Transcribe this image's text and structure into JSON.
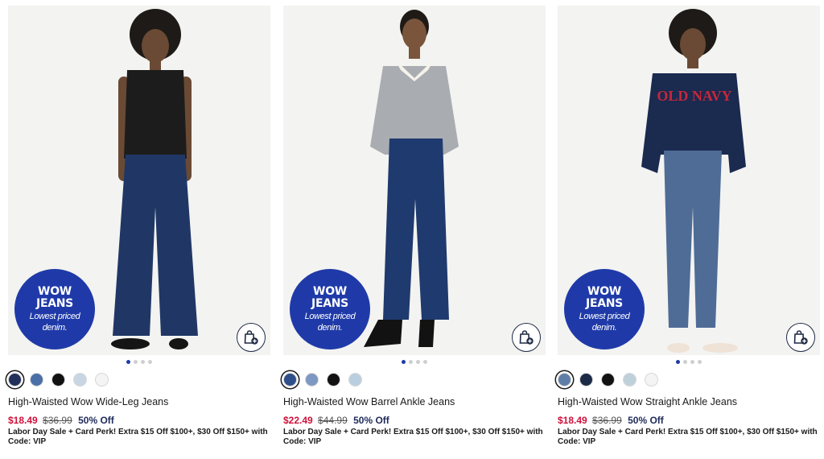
{
  "products": [
    {
      "badge_line1": "WOW",
      "badge_line2": "JEANS",
      "badge_line3": "Lowest priced",
      "badge_line4": "denim.",
      "title": "High-Waisted Wow Wide-Leg Jeans",
      "sale_price": "$18.49",
      "original_price": "$36.99",
      "discount": "50% Off",
      "promo": "Labor Day Sale + Card Perk! Extra $15 Off $100+, $30 Off $150+ with Code: VIP",
      "swatches": [
        "#22315a",
        "#4a6ea6",
        "#111111",
        "#c7d6e2",
        "#f4f4f4"
      ],
      "selected_swatch": 0,
      "active_dot": 0,
      "sweater_color": "#1c1c1c",
      "jeans_color": "#203766",
      "shoe_color": "#151515"
    },
    {
      "badge_line1": "WOW",
      "badge_line2": "JEANS",
      "badge_line3": "Lowest priced",
      "badge_line4": "denim.",
      "title": "High-Waisted Wow Barrel Ankle Jeans",
      "sale_price": "$22.49",
      "original_price": "$44.99",
      "discount": "50% Off",
      "promo": "Labor Day Sale + Card Perk! Extra $15 Off $100+, $30 Off $150+ with Code: VIP",
      "swatches": [
        "#2f4f8a",
        "#7d98c2",
        "#121212",
        "#b9cfdf"
      ],
      "selected_swatch": 0,
      "active_dot": 0,
      "sweater_color": "#a9adb2",
      "jeans_color": "#1f3a6e",
      "shoe_color": "#121212"
    },
    {
      "badge_line1": "WOW",
      "badge_line2": "JEANS",
      "badge_line3": "Lowest priced",
      "badge_line4": "denim.",
      "title": "High-Waisted Wow Straight Ankle Jeans",
      "sale_price": "$18.49",
      "original_price": "$36.99",
      "discount": "50% Off",
      "promo": "Labor Day Sale + Card Perk! Extra $15 Off $100+, $30 Off $150+ with Code: VIP",
      "swatches": [
        "#5f7ea7",
        "#1c2a48",
        "#121212",
        "#bed1db",
        "#f4f4f4"
      ],
      "selected_swatch": 0,
      "active_dot": 0,
      "sweater_color": "#1b2a4f",
      "jeans_color": "#4f6c96",
      "shoe_color": "#efe2d6"
    }
  ],
  "colors": {
    "badge_blue": "#1f3aa8",
    "sale_red": "#d0103a",
    "discount_navy": "#1f2a5a"
  },
  "icons": {
    "bag": "shopping-bag-plus-icon"
  }
}
